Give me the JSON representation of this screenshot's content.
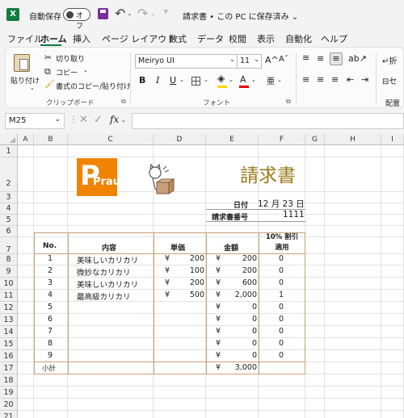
{
  "titlebar": {
    "autosave_label": "自動保存",
    "autosave_state": "オフ",
    "file_title": "請求書 • この PC に保存済み ⌄"
  },
  "menu": [
    "ファイル",
    "ホーム",
    "挿入",
    "ページ レイアウト",
    "数式",
    "データ",
    "校閲",
    "表示",
    "自動化",
    "ヘルプ"
  ],
  "ribbon": {
    "paste": "貼り付け",
    "cut": "切り取り",
    "copy": "コピー",
    "format_painter": "書式のコピー/貼り付け",
    "clipboard_group": "クリップボード",
    "font_name": "Meiryo UI",
    "font_size": "11",
    "font_group": "フォント",
    "align_group": "配置",
    "grow": "A^",
    "shrink": "Aˇ",
    "bold": "B",
    "italic": "I",
    "underline": "U",
    "fontcolor": "A",
    "phonetic": "亜",
    "wrap": "折",
    "merge": "セ"
  },
  "formula": {
    "namebox": "M25",
    "fx": "fx",
    "value": ""
  },
  "columns": [
    "A",
    "B",
    "C",
    "D",
    "E",
    "F",
    "G",
    "H",
    "I"
  ],
  "rows": [
    "1",
    "2",
    "3",
    "4",
    "5",
    "6",
    "7",
    "8",
    "9",
    "10",
    "11",
    "12",
    "13",
    "14",
    "15",
    "16",
    "17",
    "18",
    "19",
    "20",
    "21"
  ],
  "logo_text": "Prau",
  "invoice": {
    "title": "請求書",
    "date_label": "日付",
    "date_value": "12 月 23 日",
    "number_label": "請求書番号",
    "number_value": "1111"
  },
  "table": {
    "headers": {
      "no": "No.",
      "desc": "内容",
      "price": "単価",
      "amount": "金額",
      "discount": "10% 割引\n適用"
    },
    "rows": [
      {
        "no": "1",
        "desc": "美味しいカリカリ",
        "yen1": "¥",
        "price": "200",
        "yen2": "¥",
        "amount": "200",
        "disc": "0"
      },
      {
        "no": "2",
        "desc": "微妙なカリカリ",
        "yen1": "¥",
        "price": "100",
        "yen2": "¥",
        "amount": "200",
        "disc": "0"
      },
      {
        "no": "3",
        "desc": "美味しいカリカリ",
        "yen1": "¥",
        "price": "200",
        "yen2": "¥",
        "amount": "600",
        "disc": "0"
      },
      {
        "no": "4",
        "desc": "最高級カリカリ",
        "yen1": "¥",
        "price": "500",
        "yen2": "¥",
        "amount": "2,000",
        "disc": "1"
      },
      {
        "no": "5",
        "desc": "",
        "yen1": "",
        "price": "",
        "yen2": "¥",
        "amount": "0",
        "disc": "0"
      },
      {
        "no": "6",
        "desc": "",
        "yen1": "",
        "price": "",
        "yen2": "¥",
        "amount": "0",
        "disc": "0"
      },
      {
        "no": "7",
        "desc": "",
        "yen1": "",
        "price": "",
        "yen2": "¥",
        "amount": "0",
        "disc": "0"
      },
      {
        "no": "8",
        "desc": "",
        "yen1": "",
        "price": "",
        "yen2": "¥",
        "amount": "0",
        "disc": "0"
      },
      {
        "no": "9",
        "desc": "",
        "yen1": "",
        "price": "",
        "yen2": "¥",
        "amount": "0",
        "disc": "0"
      }
    ],
    "subtotal_label": "小計",
    "subtotal_yen": "¥",
    "subtotal_value": "3,000"
  },
  "colors": {
    "accent": "#107c41",
    "title_gold": "#9b7b1c",
    "border_brown": "#c9a07a",
    "logo_orange": "#f08300"
  }
}
